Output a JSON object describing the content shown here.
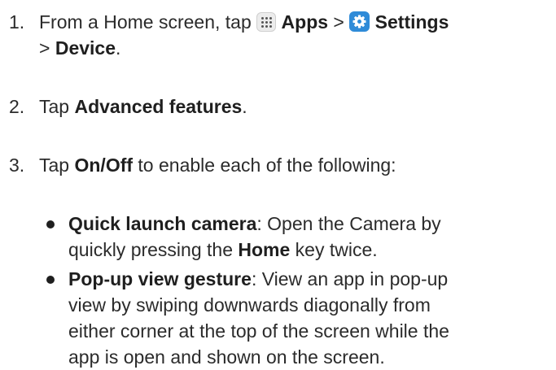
{
  "steps": [
    {
      "number": "1.",
      "text_a": "From a Home screen, tap ",
      "apps_icon": "apps-grid-icon",
      "bold_apps": "Apps",
      "sep1": " > ",
      "settings_icon": "settings-gear-icon",
      "bold_settings": "Settings",
      "sep2": "> ",
      "bold_device": "Device",
      "end": "."
    },
    {
      "number": "2.",
      "text_a": "Tap ",
      "bold": "Advanced features",
      "end": "."
    },
    {
      "number": "3.",
      "text_a": "Tap ",
      "bold": "On/Off",
      "text_b": " to enable each of the following:"
    }
  ],
  "bullets": [
    {
      "title": "Quick launch camera",
      "line1": ": Open the Camera by",
      "line2_a": "quickly pressing the ",
      "line2_bold": "Home",
      "line2_b": " key twice."
    },
    {
      "title": "Pop-up view gesture",
      "line1": ": View an app in pop-up",
      "line2": "view by swiping downwards diagonally from",
      "line3": "either corner at the top of the screen while the",
      "line4": "app is open and shown on the screen."
    }
  ],
  "colors": {
    "text": "#2b2b2b",
    "settings_icon_bg": "#2f8bd8"
  }
}
